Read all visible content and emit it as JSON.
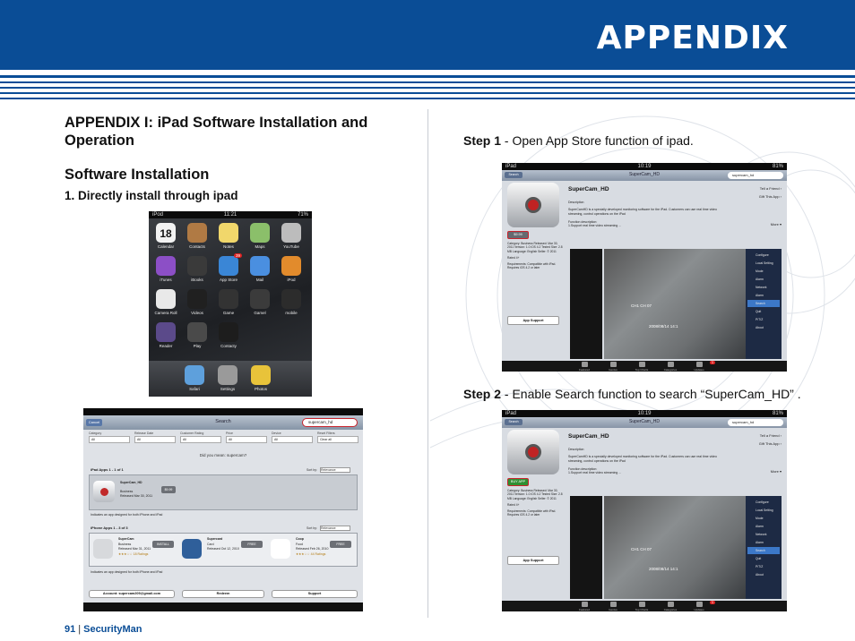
{
  "header": {
    "title": "APPENDIX"
  },
  "left": {
    "section_title": "APPENDIX I: iPad Software Installation and Operation",
    "subsection_title": "Software Installation",
    "item_title": "1. Directly install through ipad"
  },
  "right": {
    "step1_label": "Step 1",
    "step1_text": " - Open App Store function of ipad.",
    "step2_label": "Step 2",
    "step2_text": " - Enable Search function to search “SuperCam_HD” ."
  },
  "footer": {
    "page": "91",
    "separator": "|",
    "brand": "SecurityMan"
  },
  "home_screen": {
    "status_left": "iPod",
    "status_time": "11:21",
    "status_right": "71%",
    "calendar_day": "18",
    "apps": [
      {
        "label": "Calendar",
        "color": "#f2f2f2"
      },
      {
        "label": "Contacts",
        "color": "#b07a44"
      },
      {
        "label": "Notes",
        "color": "#f1d76b"
      },
      {
        "label": "Maps",
        "color": "#8bbf6a"
      },
      {
        "label": "YouTube",
        "color": "#bcbcbc"
      },
      {
        "label": "iTunes",
        "color": "#8c4fc6"
      },
      {
        "label": "iBooks",
        "color": "#3a3a3a"
      },
      {
        "label": "App Store",
        "color": "#3a86d6"
      },
      {
        "label": "Mail",
        "color": "#4a8fe0"
      },
      {
        "label": "iPod",
        "color": "#e28b2c"
      },
      {
        "label": "Camera Roll",
        "color": "#e9e9e9"
      },
      {
        "label": "Videos",
        "color": "#202020"
      },
      {
        "label": "Game",
        "color": "#333333"
      },
      {
        "label": "Gamel",
        "color": "#3b3b3b"
      },
      {
        "label": "mobile",
        "color": "#2c2c2c"
      },
      {
        "label": "Reader",
        "color": "#5b4a8a"
      },
      {
        "label": "Play",
        "color": "#4a4a4a"
      },
      {
        "label": "Contacty",
        "color": "#1d1d1d"
      }
    ],
    "dock": [
      {
        "label": "Safari",
        "color": "#5ea0dc"
      },
      {
        "label": "Settings",
        "color": "#9a9a9a"
      },
      {
        "label": "Photos",
        "color": "#e8c33a"
      }
    ],
    "app_store_badge": "39"
  },
  "search_screen": {
    "title": "Search",
    "cancel": "Cancel",
    "query": "supercam_hd",
    "filters": [
      {
        "name": "Category",
        "value": "All"
      },
      {
        "name": "Release Date",
        "value": "All"
      },
      {
        "name": "Customer Rating",
        "value": "All"
      },
      {
        "name": "Price",
        "value": "All"
      },
      {
        "name": "Device",
        "value": "All"
      },
      {
        "name": "Reset Filters",
        "value": "Clear all"
      }
    ],
    "did_you_mean": "Did you mean: supercam?",
    "ipad_apps_label": "iPad Apps  1 - 1 of 1",
    "sort_by": "Sort by:",
    "sort_value": "Relevance",
    "ipad_result": {
      "name": "SuperCam_HD",
      "category": "Business",
      "released": "Released Mar 30, 2011",
      "price": "$9.99"
    },
    "note": "Indicates an app designed for both iPhone and iPad",
    "iphone_apps_label": "iPhone Apps  1 - 3 of 3",
    "iphone_results": [
      {
        "name": "SuperCam",
        "category": "Business",
        "released": "Released Mar 31, 2011",
        "ratings": "18 Ratings",
        "price": "INSTALL"
      },
      {
        "name": "Supercard",
        "category": "Card",
        "released": "Released Oct 12, 2010",
        "ratings": "",
        "price": "FREE"
      },
      {
        "name": "Coop",
        "category": "Food",
        "released": "Released Feb 26, 2010",
        "ratings": "44 Ratings",
        "price": "FREE"
      }
    ],
    "account": "Account: supercam209@gmail.com",
    "redeem": "Redeem",
    "support": "Support"
  },
  "store_common": {
    "back": "Search",
    "nav_title": "SuperCam_HD",
    "search_query": "supercam_hd",
    "app_name": "SuperCam_HD",
    "tell_friend": "Tell a Friend",
    "gift": "Gift This App",
    "description_label": "Description",
    "description_text": "SuperCamHD is a specially developed monitoring software for the iPad. Customers can use real time video streaming, control operations on the iPad",
    "function_label": "Function description:",
    "function_text": "1.Support real time video streaming ...",
    "more": "More",
    "meta": "Category: Business  Released: Mar 30, 2011  Version: 1.0  iOS 4.2 Tested  Size: 2.8 MB  Language: English  Seller:  © 2011",
    "rated": "Rated 4+",
    "requirements": "Requirements: Compatible with iPad. Requires iOS 4.2 or later",
    "app_support": "App Support",
    "overlay_cam": "CH1  CH 07",
    "overlay_date": "2008/08/14 14:1",
    "menu": [
      "Configure",
      "Local Setting",
      "Mode",
      "Alarm",
      "Network",
      "Alarm",
      "Search",
      "Quit",
      "P/T/Z",
      "About"
    ],
    "tabs": [
      "Featured",
      "Genius",
      "Top Charts",
      "Categories",
      "Updates"
    ],
    "updates_badge": "1"
  },
  "store1": {
    "status_left": "iPad",
    "status_time": "10:19",
    "status_right": "81%",
    "price": "$9.99"
  },
  "store2": {
    "status_left": "iPad",
    "status_time": "10:19",
    "status_right": "81%",
    "price": "BUY APP"
  }
}
